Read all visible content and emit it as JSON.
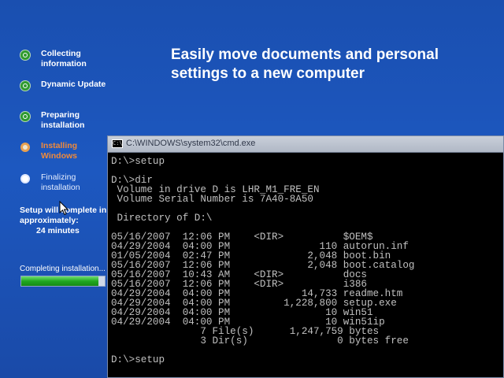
{
  "steps": [
    {
      "label": "Collecting information",
      "state": "done"
    },
    {
      "label": "Dynamic Update",
      "state": "done"
    },
    {
      "label": "Preparing installation",
      "state": "done"
    },
    {
      "label": "Installing Windows",
      "state": "current"
    },
    {
      "label": "Finalizing installation",
      "state": "pending"
    }
  ],
  "eta": {
    "text": "Setup will complete in approximately:",
    "minutes": "24 minutes"
  },
  "progress": {
    "label": "Completing installation...",
    "fraction": 0.92
  },
  "headline": "Easily move documents and personal settings to a new computer",
  "cmd": {
    "title": "C:\\WINDOWS\\system32\\cmd.exe",
    "icon_text": "C:\\",
    "lines": [
      "D:\\>setup",
      "",
      "D:\\>dir",
      " Volume in drive D is LHR_M1_FRE_EN",
      " Volume Serial Number is 7A40-8A50",
      "",
      " Directory of D:\\",
      "",
      "05/16/2007  12:06 PM    <DIR>          $OEM$",
      "04/29/2004  04:00 PM               110 autorun.inf",
      "01/05/2004  02:47 PM             2,048 boot.bin",
      "05/16/2007  12:06 PM             2,048 boot.catalog",
      "05/16/2007  10:43 AM    <DIR>          docs",
      "05/16/2007  12:06 PM    <DIR>          i386",
      "04/29/2004  04:00 PM            14,733 readme.htm",
      "04/29/2004  04:00 PM         1,228,800 setup.exe",
      "04/29/2004  04:00 PM                10 win51",
      "04/29/2004  04:00 PM                10 win51ip",
      "               7 File(s)      1,247,759 bytes",
      "               3 Dir(s)               0 bytes free",
      "",
      "D:\\>setup"
    ]
  },
  "colors": {
    "background": "#1d58c0",
    "done": "#2f9a2f",
    "current": "#f08a3a",
    "console_text": "#c0c0c0"
  },
  "icons": {
    "cmd": "console-icon",
    "cursor": "mouse-pointer-icon"
  }
}
